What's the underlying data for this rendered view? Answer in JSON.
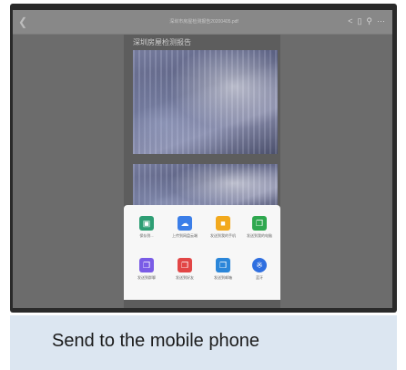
{
  "window": {
    "document_name": "深圳市房屋检测报告20200405.pdf",
    "back_icon": "chevron-left-icon",
    "toolbar_icons": [
      "share-icon",
      "bookmark-icon",
      "search-icon",
      "more-icon"
    ]
  },
  "document": {
    "title": "深圳房屋检测报告"
  },
  "share_sheet": {
    "items": [
      {
        "label": "保存到...",
        "icon": "image-icon",
        "color": "#2e9e74"
      },
      {
        "label": "上传到网盘云端",
        "icon": "cloud-icon",
        "color": "#3b7ee8"
      },
      {
        "label": "发送到我的手机",
        "icon": "folder-icon",
        "color": "#f2a91d"
      },
      {
        "label": "发送到我的电脑",
        "icon": "copy-icon",
        "color": "#2fa84f"
      },
      {
        "label": "发送到群聊",
        "icon": "copy-icon",
        "color": "#7a5ce6"
      },
      {
        "label": "发送到好友",
        "icon": "copy-icon",
        "color": "#e24646"
      },
      {
        "label": "发送到邮箱",
        "icon": "copy-icon",
        "color": "#2b86d9"
      },
      {
        "label": "蓝牙",
        "icon": "bluetooth-icon",
        "color": "#2f6fe0"
      }
    ]
  },
  "caption": "Send to the mobile phone"
}
